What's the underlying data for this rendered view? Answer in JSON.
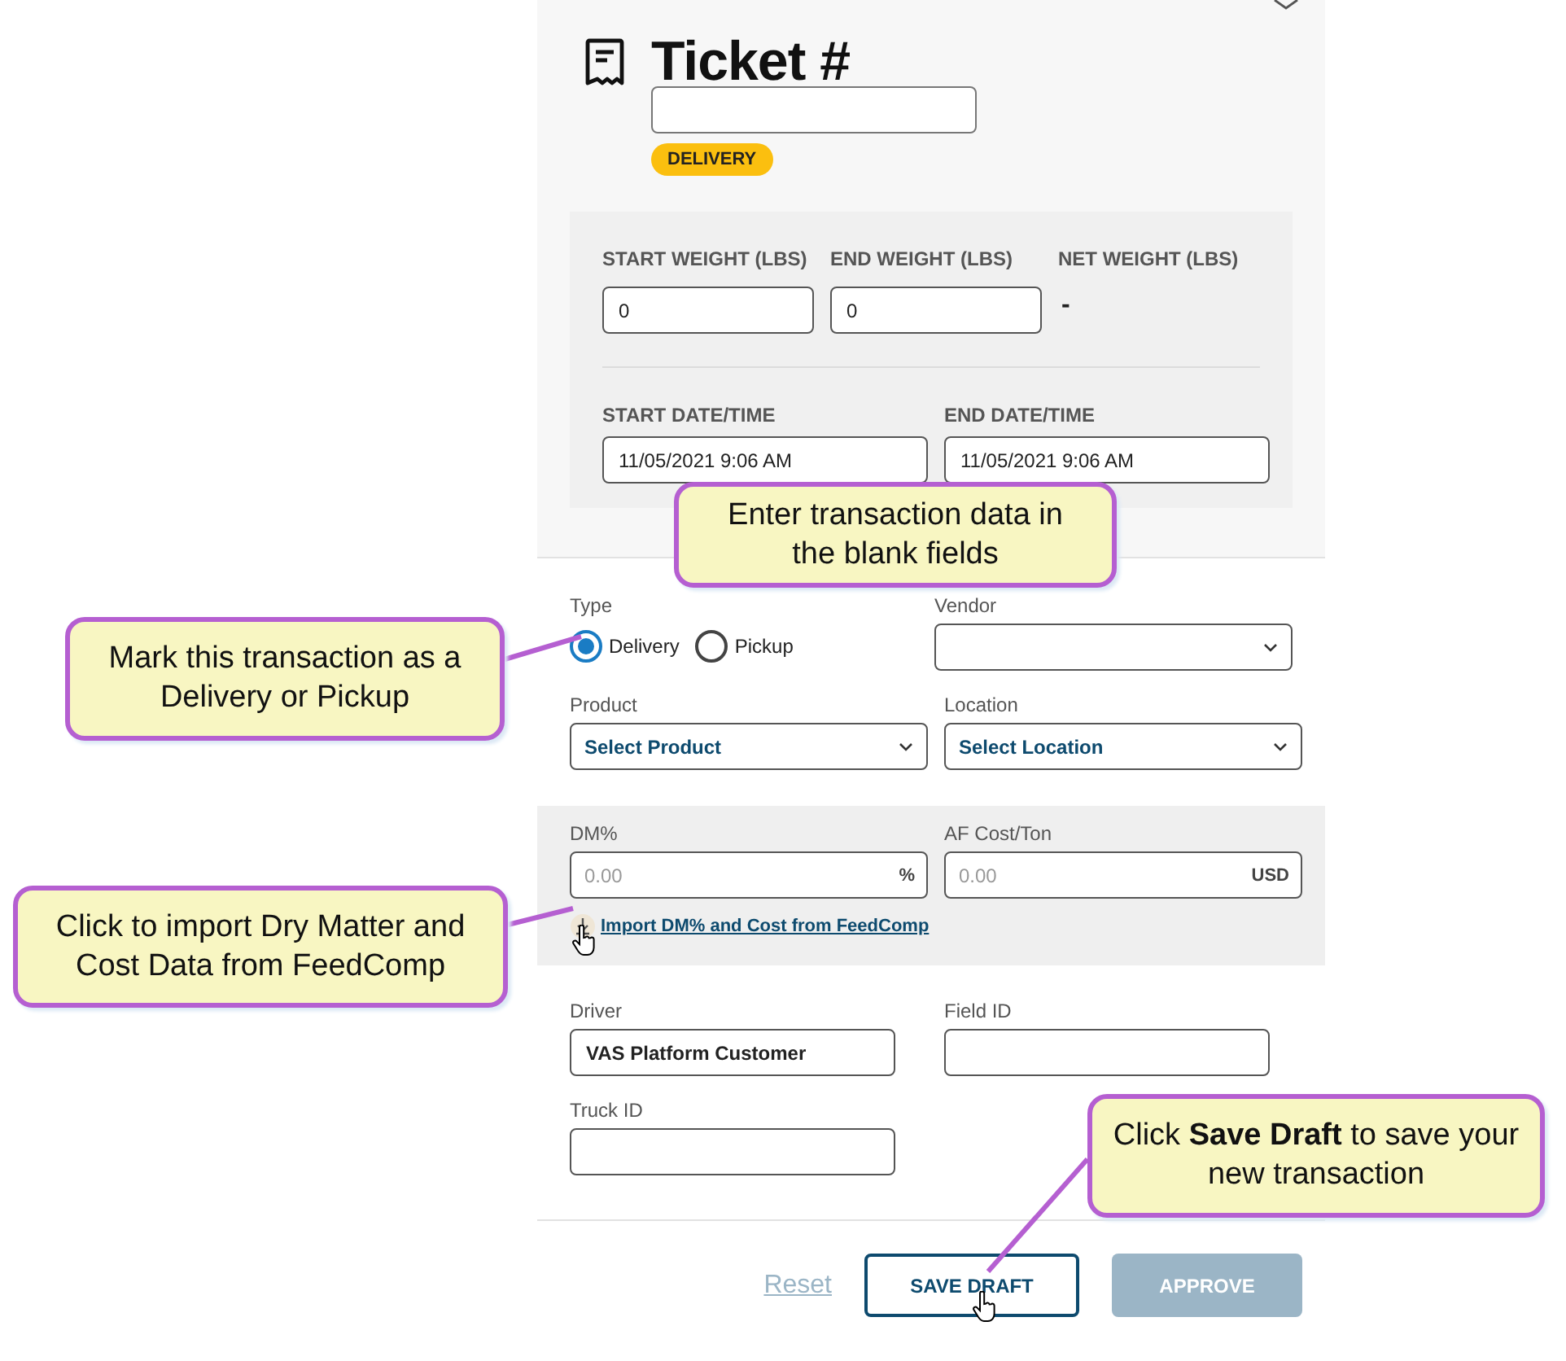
{
  "panel": {
    "title": "Ticket #",
    "badge": "DELIVERY",
    "weights": [
      {
        "label": "START WEIGHT (LBS)",
        "value": "0"
      },
      {
        "label": "END WEIGHT (LBS)",
        "value": "0"
      }
    ],
    "net_weight": {
      "label": "NET WEIGHT (LBS)",
      "value": "-"
    },
    "dates": [
      {
        "label": "START DATE/TIME",
        "value": "11/05/2021 9:06 AM"
      },
      {
        "label": "END DATE/TIME",
        "value": "11/05/2021 9:06 AM"
      }
    ],
    "type": {
      "label": "Type",
      "options": [
        {
          "label": "Delivery",
          "selected": true
        },
        {
          "label": "Pickup",
          "selected": false
        }
      ]
    },
    "vendor": {
      "label": "Vendor"
    },
    "product": {
      "label": "Product",
      "value": "Select Product"
    },
    "location": {
      "label": "Location",
      "value": "Select Location"
    },
    "dm": {
      "label": "DM%",
      "placeholder": "0.00",
      "unit": "%"
    },
    "af_cost": {
      "label": "AF Cost/Ton",
      "placeholder": "0.00",
      "unit": "USD"
    },
    "import_link": "Import DM% and Cost from FeedComp",
    "driver": {
      "label": "Driver",
      "value": "VAS Platform Customer"
    },
    "field_id": {
      "label": "Field ID"
    },
    "truck_id": {
      "label": "Truck ID"
    },
    "buttons": [
      {
        "label": "Reset",
        "kind": "link",
        "disabled": true
      },
      {
        "label": "SAVE DRAFT",
        "kind": "outline",
        "disabled": false
      },
      {
        "label": "APPROVE",
        "kind": "primary",
        "disabled": true
      }
    ]
  },
  "callouts": [
    {
      "text": "Enter transaction data in the blank fields"
    },
    {
      "text": "Mark this transaction as a Delivery or Pickup"
    },
    {
      "text": "Click to import Dry Matter and Cost Data from FeedComp"
    },
    {
      "text": "Click **Save Draft** to save your new transaction"
    }
  ]
}
